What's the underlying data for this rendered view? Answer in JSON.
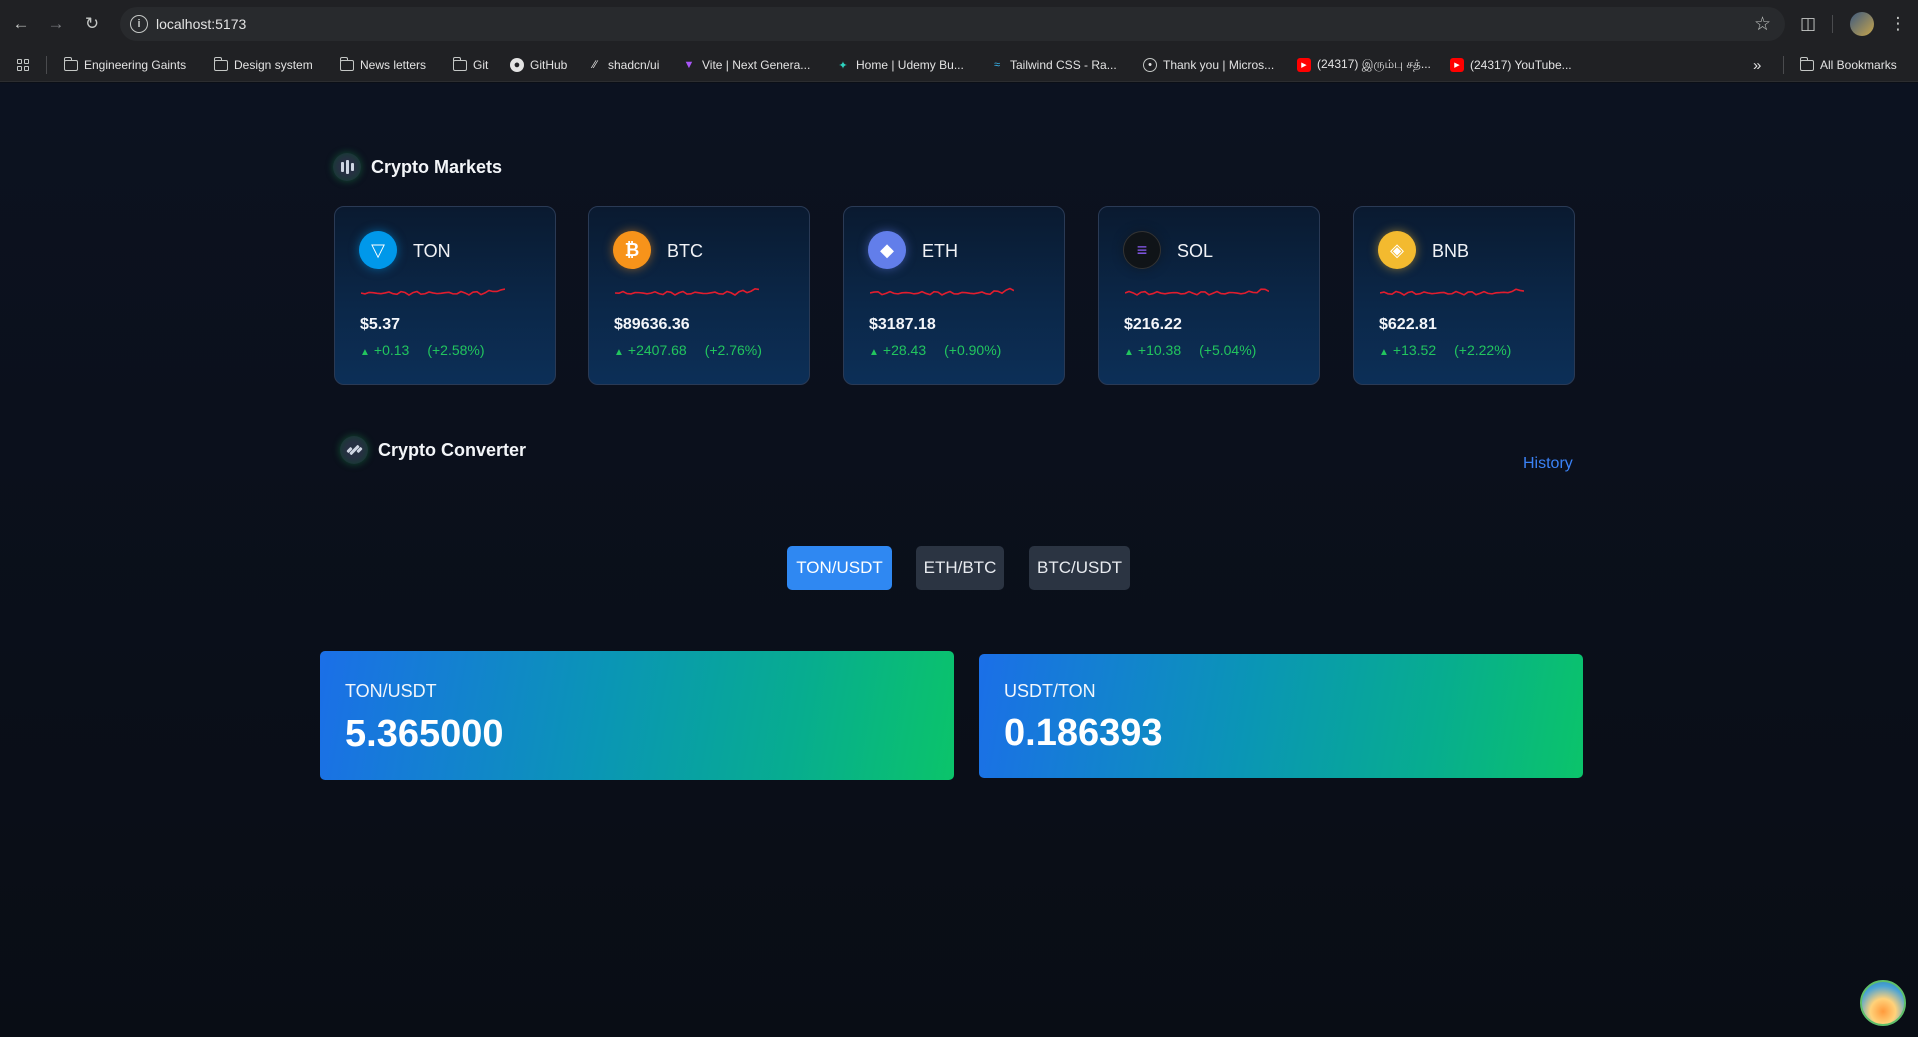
{
  "browser": {
    "url": "localhost:5173",
    "bookmarks": [
      {
        "label": "Engineering Gaints",
        "icon": "folder-icon"
      },
      {
        "label": "Design system",
        "icon": "folder-icon"
      },
      {
        "label": "News letters",
        "icon": "folder-icon"
      },
      {
        "label": "Git",
        "icon": "folder-icon"
      },
      {
        "label": "GitHub",
        "icon": "github-icon"
      },
      {
        "label": "shadcn/ui",
        "icon": "shadcn-icon"
      },
      {
        "label": "Vite | Next Genera...",
        "icon": "vite-icon"
      },
      {
        "label": "Home | Udemy Bu...",
        "icon": "udemy-icon"
      },
      {
        "label": "Tailwind CSS - Ra...",
        "icon": "tailwind-icon"
      },
      {
        "label": "Thank you | Micros...",
        "icon": "globe-icon"
      },
      {
        "label": "(24317) இரும்பு சத்...",
        "icon": "youtube-icon"
      },
      {
        "label": "(24317) YouTube...",
        "icon": "youtube-icon"
      }
    ],
    "all_bookmarks": "All Bookmarks",
    "overflow": "»"
  },
  "markets": {
    "title": "Crypto Markets",
    "coins": [
      {
        "symbol": "TON",
        "price": "$5.37",
        "change": "+0.13",
        "percent": "(+2.58%)",
        "color": "#0098ea",
        "glyph": "▽"
      },
      {
        "symbol": "BTC",
        "price": "$89636.36",
        "change": "+2407.68",
        "percent": "(+2.76%)",
        "color": "#f7931a",
        "glyph": "₿"
      },
      {
        "symbol": "ETH",
        "price": "$3187.18",
        "change": "+28.43",
        "percent": "(+0.90%)",
        "color": "#627eea",
        "glyph": "◆"
      },
      {
        "symbol": "SOL",
        "price": "$216.22",
        "change": "+10.38",
        "percent": "(+5.04%)",
        "color": "#101418",
        "glyph": "≡"
      },
      {
        "symbol": "BNB",
        "price": "$622.81",
        "change": "+13.52",
        "percent": "(+2.22%)",
        "color": "#f3ba2f",
        "glyph": "◈"
      }
    ],
    "sparkline_color": "#e11d2e",
    "up_color": "#22c55e"
  },
  "converter": {
    "title": "Crypto Converter",
    "history_label": "History",
    "pairs": [
      "TON/USDT",
      "ETH/BTC",
      "BTC/USDT"
    ],
    "active_pair": "TON/USDT",
    "rates": [
      {
        "label": "TON/USDT",
        "value": "5.365000"
      },
      {
        "label": "USDT/TON",
        "value": "0.186393"
      }
    ]
  }
}
